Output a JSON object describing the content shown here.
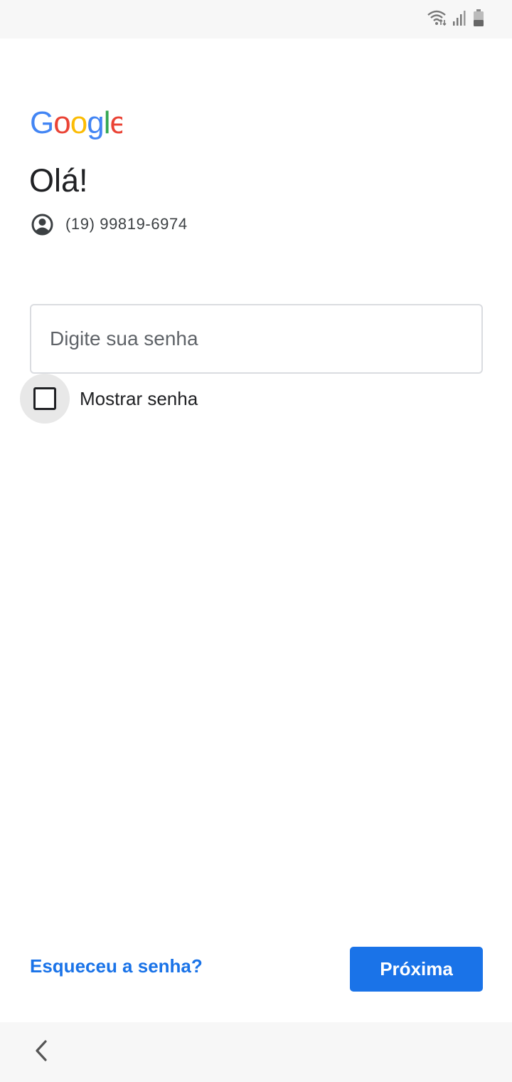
{
  "status_bar": {
    "icons": [
      "wifi-icon",
      "cellular-signal-icon",
      "battery-icon"
    ]
  },
  "logo": {
    "text": "Google",
    "colors": [
      "#4285F4",
      "#EA4335",
      "#FBBC05",
      "#4285F4",
      "#34A853",
      "#EA4335"
    ]
  },
  "greeting": "Olá!",
  "account": {
    "icon": "account-circle-icon",
    "identifier": "(19) 99819-6974"
  },
  "password_field": {
    "placeholder": "Digite sua senha",
    "value": ""
  },
  "show_password": {
    "label": "Mostrar senha",
    "checked": false
  },
  "forgot_link": "Esqueceu a senha?",
  "next_button": "Próxima",
  "nav_bar": {
    "icon": "back-chevron-icon"
  },
  "colors": {
    "accent": "#1a73e8",
    "text_primary": "#202124",
    "border": "#dadce0"
  }
}
